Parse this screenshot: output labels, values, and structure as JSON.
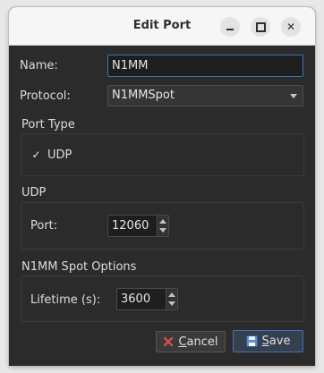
{
  "window": {
    "title": "Edit Port"
  },
  "titlebar_buttons": {
    "minimize": "minimize-icon",
    "maximize": "maximize-icon",
    "close": "close-icon"
  },
  "form": {
    "name_label": "Name:",
    "name_value": "N1MM",
    "protocol_label": "Protocol:",
    "protocol_value": "N1MMSpot"
  },
  "port_type": {
    "title": "Port Type",
    "udp_label": "UDP",
    "udp_checked": true
  },
  "udp": {
    "title": "UDP",
    "port_label": "Port:",
    "port_value": "12060"
  },
  "n1mm_options": {
    "title": "N1MM Spot Options",
    "lifetime_label": "Lifetime (s):",
    "lifetime_value": "3600"
  },
  "buttons": {
    "cancel_first": "C",
    "cancel_rest": "ancel",
    "save_first": "S",
    "save_rest": "ave",
    "cancel_icon": "cancel-x-icon",
    "save_icon": "floppy-disk-icon"
  },
  "colors": {
    "accent": "#3d74b5",
    "cancel_icon": "#d9534f",
    "dialog_bg": "#2b2b2b"
  }
}
